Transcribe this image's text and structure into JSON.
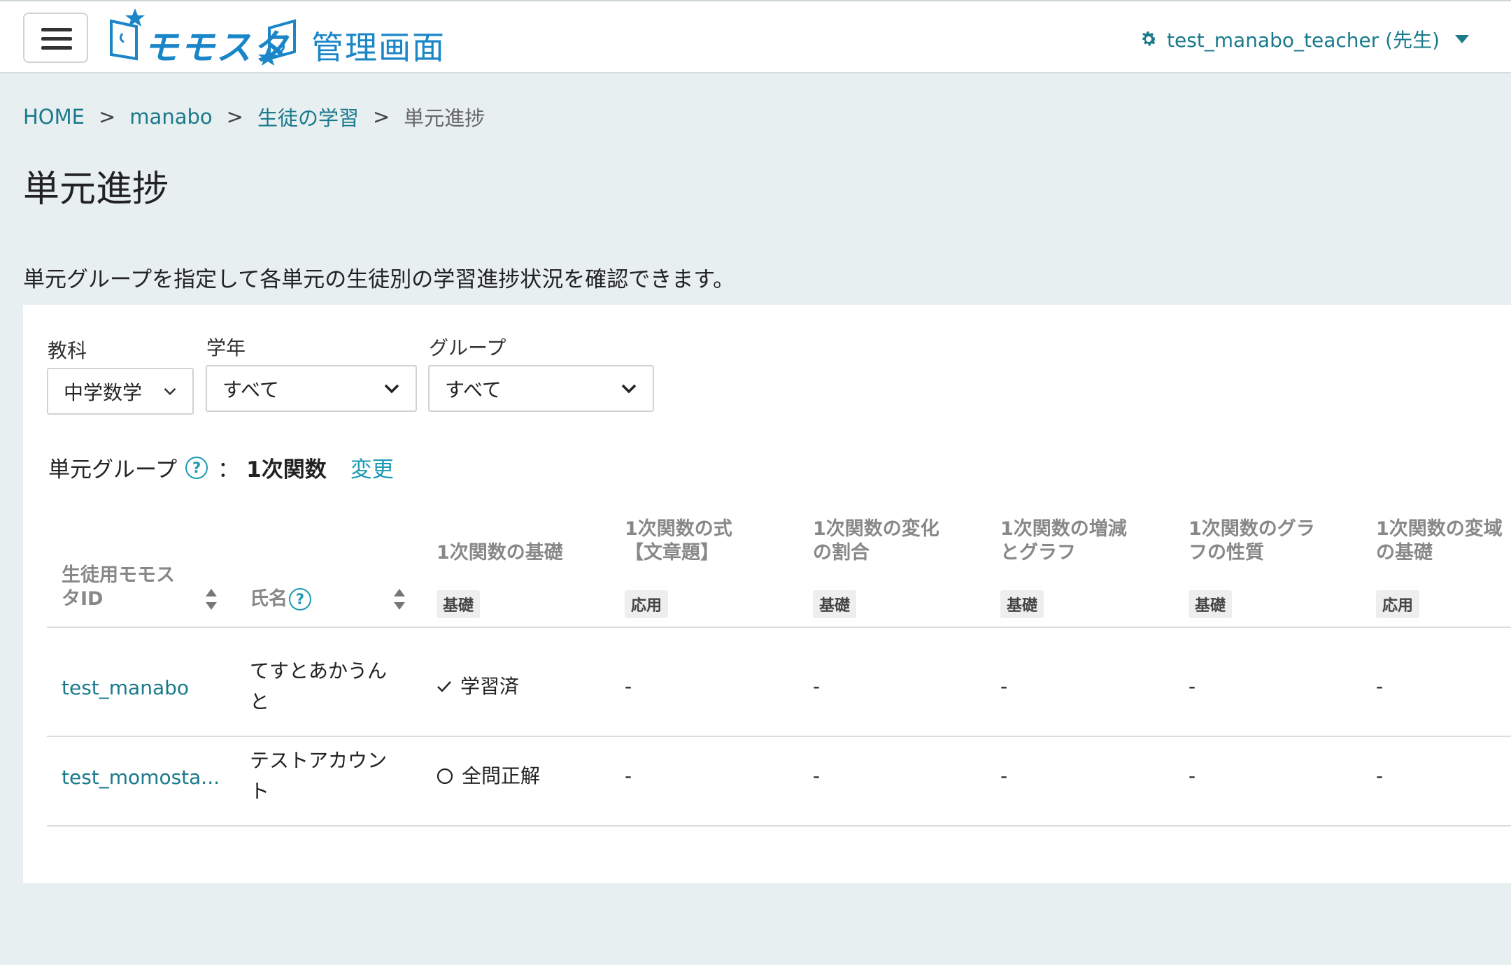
{
  "header": {
    "logo_text": "モモスタ",
    "logo_admin": "管理画面",
    "user": "test_manabo_teacher (先生)"
  },
  "breadcrumb": [
    {
      "label": "HOME"
    },
    {
      "label": "manabo"
    },
    {
      "label": "生徒の学習"
    },
    {
      "label": "単元進捗"
    }
  ],
  "breadcrumb_sep": ">",
  "page_title": "単元進捗",
  "description": "単元グループを指定して各単元の生徒別の学習進捗状況を確認できます。",
  "filters": {
    "subject": {
      "label": "教科",
      "value": "中学数学"
    },
    "grade": {
      "label": "学年",
      "value": "すべて"
    },
    "group": {
      "label": "グループ",
      "value": "すべて"
    }
  },
  "unit_group": {
    "label": "単元グループ",
    "help": "?",
    "colon": "：",
    "value": "1次関数",
    "change": "変更"
  },
  "table": {
    "columns": {
      "student_id": {
        "line1": "生徒用モモス",
        "line2": "タID"
      },
      "name": {
        "label": "氏名",
        "help": "?"
      }
    },
    "units": [
      {
        "line1": "",
        "line2": "1次関数の基礎",
        "tag": "基礎"
      },
      {
        "line1": "1次関数の式",
        "line2": "【文章題】",
        "tag": "応用"
      },
      {
        "line1": "1次関数の変化",
        "line2": "の割合",
        "tag": "基礎"
      },
      {
        "line1": "1次関数の増減",
        "line2": "とグラフ",
        "tag": "基礎"
      },
      {
        "line1": "1次関数のグラ",
        "line2": "フの性質",
        "tag": "基礎"
      },
      {
        "line1": "1次関数の変域",
        "line2": "の基礎",
        "tag": "応用"
      }
    ],
    "rows": [
      {
        "id": "test_manabo",
        "name_line1": "てすとあかうん",
        "name_line2": "と",
        "status": "学習済",
        "status_icon": "check-icon",
        "cells": [
          "-",
          "-",
          "-",
          "-",
          "-"
        ]
      },
      {
        "id": "test_momosta...",
        "name_line1": "テストアカウン",
        "name_line2": "ト",
        "status": "全問正解",
        "status_icon": "circle-icon",
        "cells": [
          "-",
          "-",
          "-",
          "-",
          "-"
        ]
      }
    ]
  },
  "colors": {
    "accent": "#1a7a8c",
    "logo": "#1a86c8",
    "background": "#e8eff1"
  }
}
